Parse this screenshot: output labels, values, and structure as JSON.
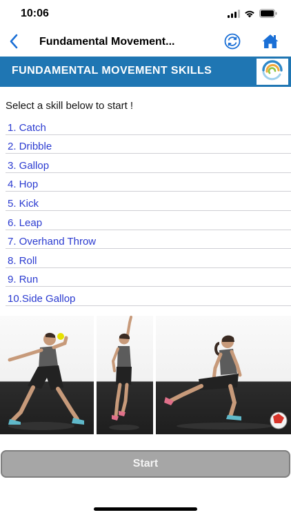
{
  "status": {
    "time": "10:06",
    "signal_icon": "cellular-signal-icon",
    "wifi_icon": "wifi-icon",
    "battery_icon": "battery-icon"
  },
  "nav": {
    "title": "Fundamental Movement...",
    "back_icon": "chevron-left-icon",
    "refresh_icon": "refresh-icon",
    "home_icon": "home-icon",
    "accent_color": "#1a6fd6"
  },
  "banner": {
    "title": "FUNDAMENTAL MOVEMENT SKILLS",
    "background_color": "#1f76b3",
    "logo_icon": "swirl-logo-icon"
  },
  "intro": "Select a skill below to start !",
  "skills": [
    {
      "label": "1. Catch"
    },
    {
      "label": "2. Dribble"
    },
    {
      "label": "3. Gallop"
    },
    {
      "label": "4. Hop"
    },
    {
      "label": "5. Kick"
    },
    {
      "label": "6. Leap"
    },
    {
      "label": "7. Overhand Throw"
    },
    {
      "label": "8. Roll"
    },
    {
      "label": "9. Run"
    },
    {
      "label": "10.Side Gallop"
    }
  ],
  "photos": [
    {
      "name": "throw-photo"
    },
    {
      "name": "jump-photo"
    },
    {
      "name": "kick-photo"
    }
  ],
  "start_label": "Start",
  "link_color": "#2a3ad0"
}
